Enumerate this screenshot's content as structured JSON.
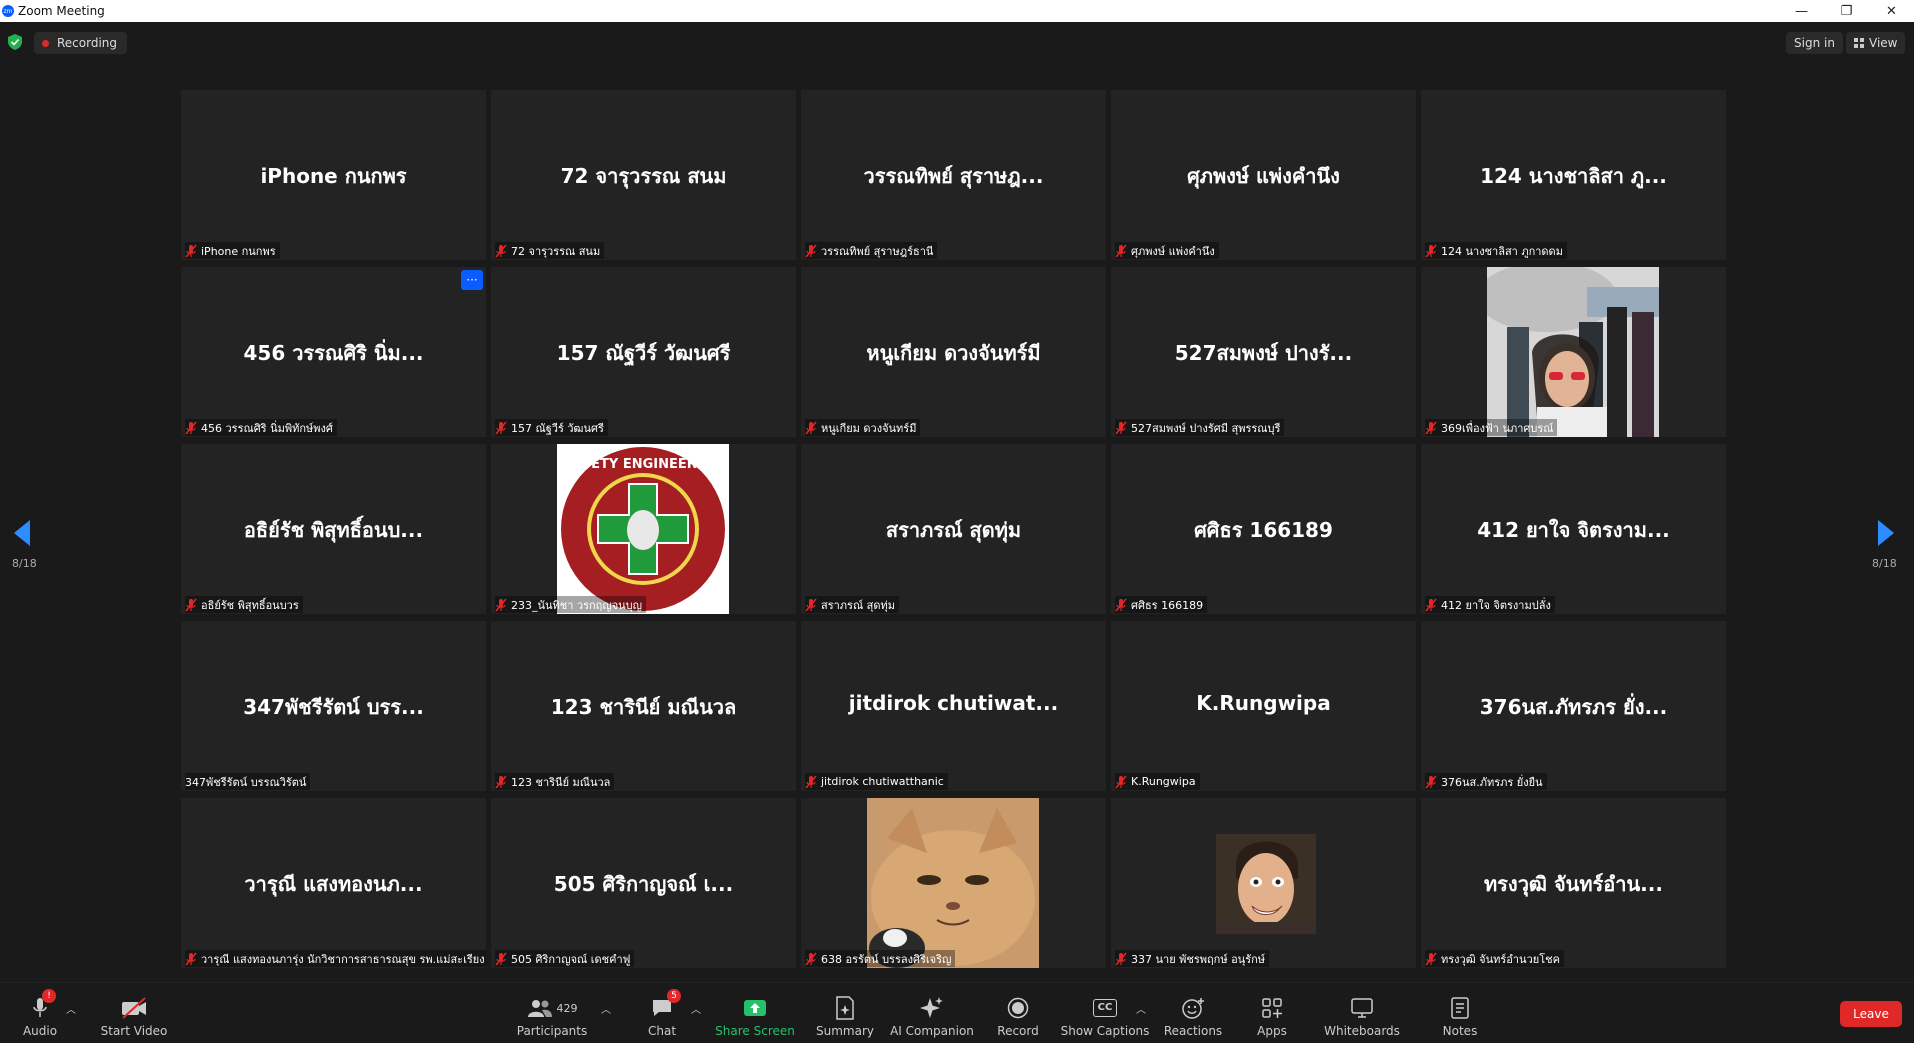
{
  "window": {
    "title": "Zoom Meeting",
    "controls": [
      "—",
      "❐",
      "✕"
    ]
  },
  "topbar": {
    "recording": "Recording",
    "sign_in": "Sign in",
    "view": "View"
  },
  "pagination": {
    "left": "8/18",
    "right": "8/18"
  },
  "tiles": [
    {
      "big": "iPhone กนกพร",
      "label": "iPhone กนกพร",
      "muted": true
    },
    {
      "big": "72 จารุวรรณ สนม",
      "label": "72 จารุวรรณ สนม",
      "muted": true
    },
    {
      "big": "วรรณทิพย์ สุราษฎ...",
      "label": "วรรณทิพย์ สุราษฎร์ธานี",
      "muted": true
    },
    {
      "big": "ศุภพงษ์ แพ่งคำนึง",
      "label": "ศุภพงษ์ แพ่งคำนึง",
      "muted": true
    },
    {
      "big": "124 นางชาลิสา ภู...",
      "label": "124 นางชาลิสา ภูกาดดม",
      "muted": true
    },
    {
      "big": "456 วรรณศิริ นิ่ม...",
      "label": "456 วรรณศิริ นิ่มพิทักษ์พงศ์",
      "muted": true,
      "more": "···"
    },
    {
      "big": "157 ณัฐวีร์ วัฒนศรี",
      "label": "157 ณัฐวีร์ วัฒนศรี",
      "muted": true
    },
    {
      "big": "หนูเกียม ดวงจันทร์มี",
      "label": "หนูเกียม ดวงจันทร์มี",
      "muted": true
    },
    {
      "big": "527สมพงษ์ ปางรั...",
      "label": "527สมพงษ์ ปางรัศมี สุพรรณบุรี",
      "muted": true
    },
    {
      "big": "",
      "label": "369เพื่องฟ้า นภาศบรณ์",
      "muted": true,
      "image": "photo-woman-red-sunglasses"
    },
    {
      "big": "อธิย์รัช พิสุทธิ์อนบ...",
      "label": "อธิย์รัช พิสุทธิ์อนบวร",
      "muted": true
    },
    {
      "big": "",
      "label": "233_นันทิชา วรกฤญจนบุญ",
      "muted": true,
      "image": "safety-engineering-logo"
    },
    {
      "big": "สราภรณ์ สุดทุ่ม",
      "label": "สราภรณ์ สุดทุ่ม",
      "muted": true
    },
    {
      "big": "ศศิธร 166189",
      "label": "ศศิธร 166189",
      "muted": true
    },
    {
      "big": "412 ยาใจ จิตรงาม...",
      "label": "412 ยาใจ จิตรงามปลั่ง",
      "muted": true
    },
    {
      "big": "347พัชรีรัตน์ บรร...",
      "label": "347พัชรีรัตน์ บรรณวิรัตน์",
      "muted": false
    },
    {
      "big": "123 ชารินีย์ มณีนวล",
      "label": "123 ชารินีย์ มณีนวล",
      "muted": true
    },
    {
      "big": "jitdirok chutiwat...",
      "label": "jitdirok chutiwatthanic",
      "muted": true
    },
    {
      "big": "K.Rungwipa",
      "label": "K.Rungwipa",
      "muted": true
    },
    {
      "big": "376นส.ภัทรภร ยั่ง...",
      "label": "376นส.ภัทรภร ยั่งยืน",
      "muted": true
    },
    {
      "big": "วารุณี แสงทองนภ...",
      "label": "วารุณี แสงทองนภารุ่ง นักวิชาการสาธารณสุข รพ.แม่สะเรียง",
      "muted": true
    },
    {
      "big": "505 ศิริกาญจณ์ เ...",
      "label": "505 ศิริกาญจณ์ เดชคำฟู",
      "muted": true
    },
    {
      "big": "",
      "label": "638 อรรัตน์ บรรลงศิริเจริญ",
      "muted": true,
      "image": "photo-cat"
    },
    {
      "big": "",
      "label": "337 นาย พัชรพฤกษ์ อนุรักษ์",
      "muted": true,
      "image": "photo-man-face"
    },
    {
      "big": "ทรงวุฒิ จันทร์อำน...",
      "label": "ทรงวุฒิ จันทร์อำนวยโชค",
      "muted": true
    }
  ],
  "toolbar": {
    "audio": {
      "label": "Audio",
      "badge": "!"
    },
    "start_video": {
      "label": "Start Video"
    },
    "participants": {
      "label": "Participants",
      "count": "429"
    },
    "chat": {
      "label": "Chat",
      "badge": "5"
    },
    "share_screen": {
      "label": "Share Screen"
    },
    "summary": {
      "label": "Summary"
    },
    "ai_companion": {
      "label": "AI Companion"
    },
    "record": {
      "label": "Record"
    },
    "show_captions": {
      "label": "Show Captions",
      "icon_text": "CC"
    },
    "reactions": {
      "label": "Reactions"
    },
    "apps": {
      "label": "Apps"
    },
    "whiteboards": {
      "label": "Whiteboards"
    },
    "notes": {
      "label": "Notes"
    },
    "leave": {
      "label": "Leave"
    }
  },
  "colors": {
    "accent_blue": "#0b5cff",
    "leave_red": "#e02828",
    "share_green": "#27c06a",
    "arrow_blue": "#2d8cff"
  }
}
